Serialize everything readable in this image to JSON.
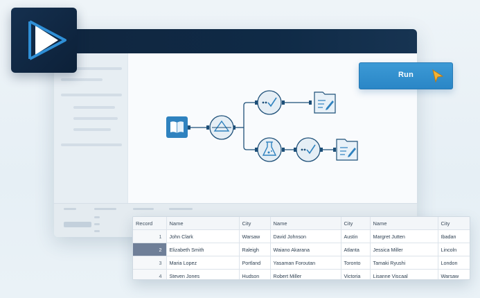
{
  "toolbar": {
    "run_label": "Run"
  },
  "grid": {
    "columns": [
      "Record",
      "Name",
      "City",
      "Name",
      "City",
      "Name",
      "City"
    ],
    "rows": [
      [
        "1",
        "John Clark",
        "Warsaw",
        "David Johnson",
        "Austin",
        "Margret Jutten",
        "Ibadan"
      ],
      [
        "2",
        "Elizabeth Smith",
        "Raleigh",
        "Waiano Akarana",
        "Atlanta",
        "Jessica Miller",
        "Lincoln"
      ],
      [
        "3",
        "Maria Lopez",
        "Portland",
        "Yasaman Foroutan",
        "Toronto",
        "Tamaki Ryushi",
        "London"
      ],
      [
        "4",
        "Steven Jones",
        "Hudson",
        "Robert Miller",
        "Victoria",
        "Lisanne Viscaal",
        "Warsaw"
      ]
    ],
    "selected_row": 2
  },
  "icons": {
    "app_logo": "play-logo-icon",
    "cursor": "cursor-arrow-icon",
    "workflow": [
      "input-book-icon",
      "filter-icon",
      "check-icon",
      "output-document-icon",
      "formula-flask-icon",
      "check-icon",
      "output-document-icon"
    ]
  },
  "colors": {
    "accent": "#2a86c6",
    "titlebar": "#10263f",
    "node_blue": "#1d6fa5",
    "selected_row": "#6f7f98"
  }
}
